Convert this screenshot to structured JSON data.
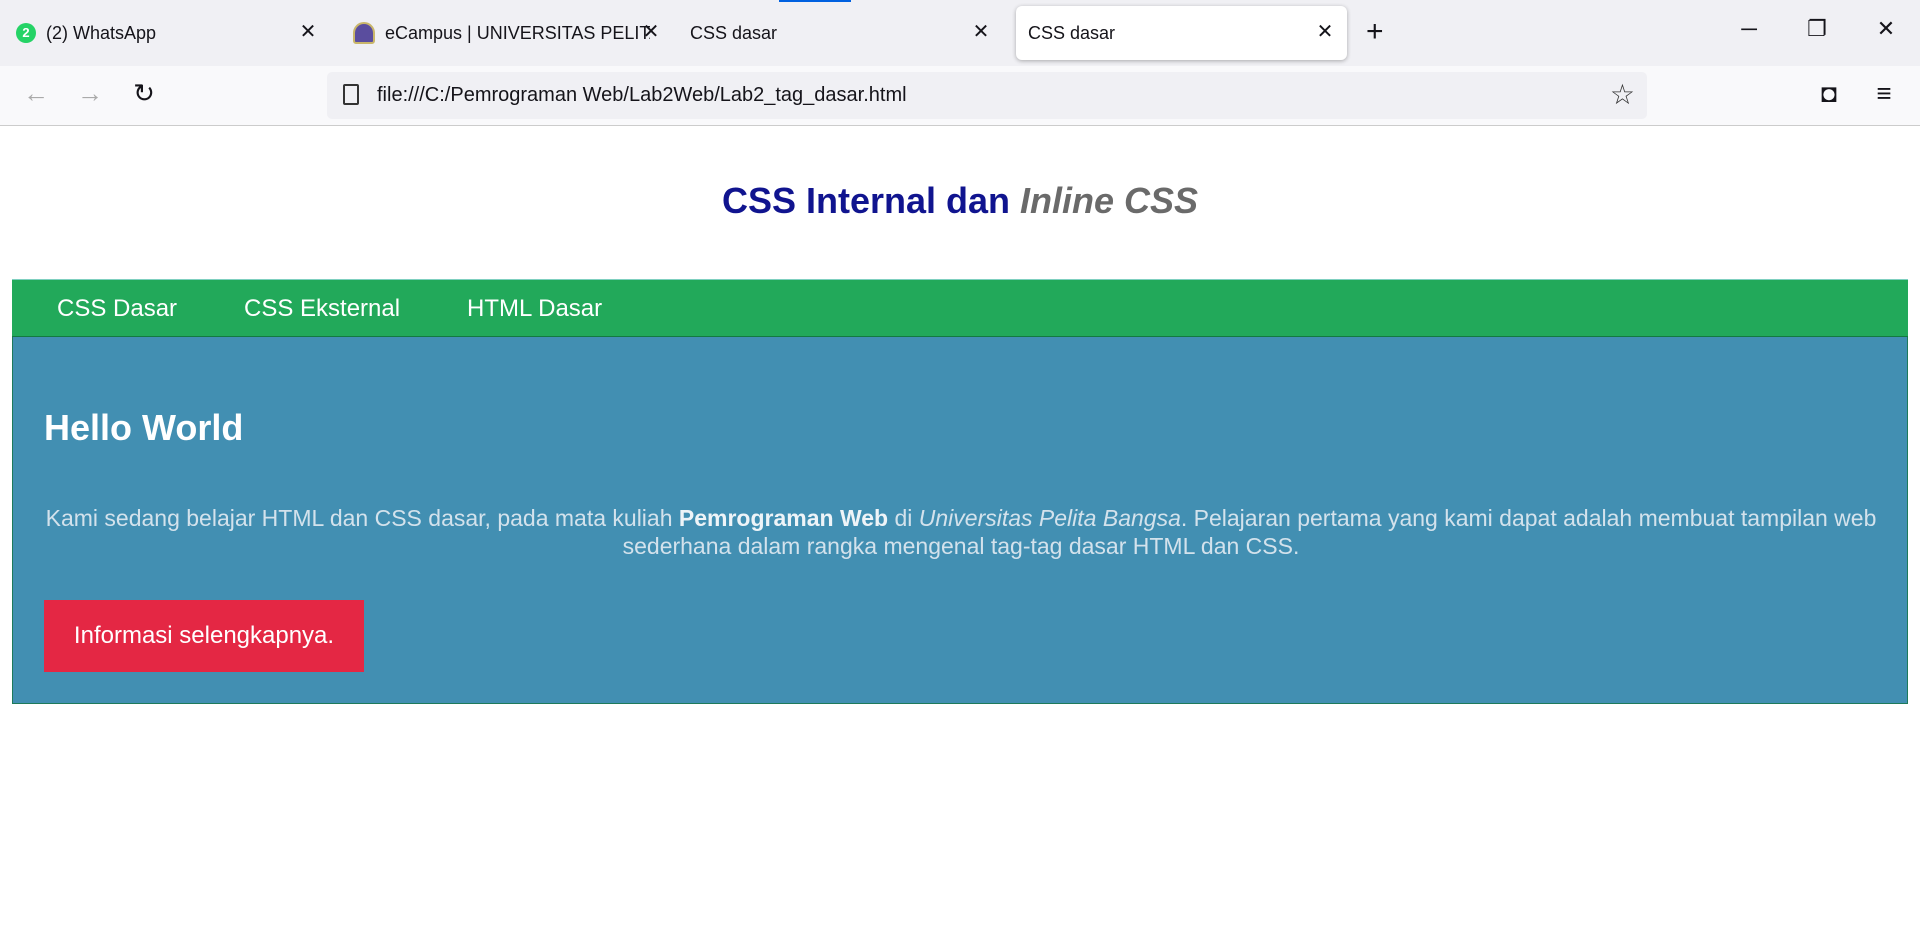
{
  "browser": {
    "tabs": [
      {
        "label": "(2) WhatsApp",
        "badge": "2"
      },
      {
        "label": "eCampus | UNIVERSITAS PELITA"
      },
      {
        "label": "CSS dasar"
      },
      {
        "label": "CSS dasar",
        "active": true
      }
    ],
    "close_glyph": "✕",
    "new_tab": "+",
    "window": {
      "minimize": "─",
      "restore": "❐",
      "close": "✕"
    },
    "back": "←",
    "forward": "→",
    "reload": "↻",
    "url": "file:///C:/Pemrograman Web/Lab2Web/Lab2_tag_dasar.html",
    "star": "☆",
    "pocket": "◘",
    "menu": "≡"
  },
  "page": {
    "title_main": "CSS Internal dan ",
    "title_italic": "Inline CSS",
    "nav": [
      "CSS Dasar",
      "CSS Eksternal",
      "HTML Dasar"
    ],
    "heading": "Hello World",
    "para": {
      "p1": "Kami sedang belajar HTML dan CSS dasar, pada mata kuliah ",
      "bold": "Pemrograman Web",
      "p2": " di ",
      "italic": "Universitas Pelita Bangsa",
      "p3": ". Pelajaran pertama yang kami dapat adalah membuat tampilan web sederhana dalam rangka mengenal tag-tag dasar HTML dan CSS."
    },
    "button": "Informasi selengkapnya."
  },
  "colors": {
    "nav": "#22a95a",
    "content": "#428fb2",
    "button": "#e42744",
    "title": "#10148f"
  }
}
